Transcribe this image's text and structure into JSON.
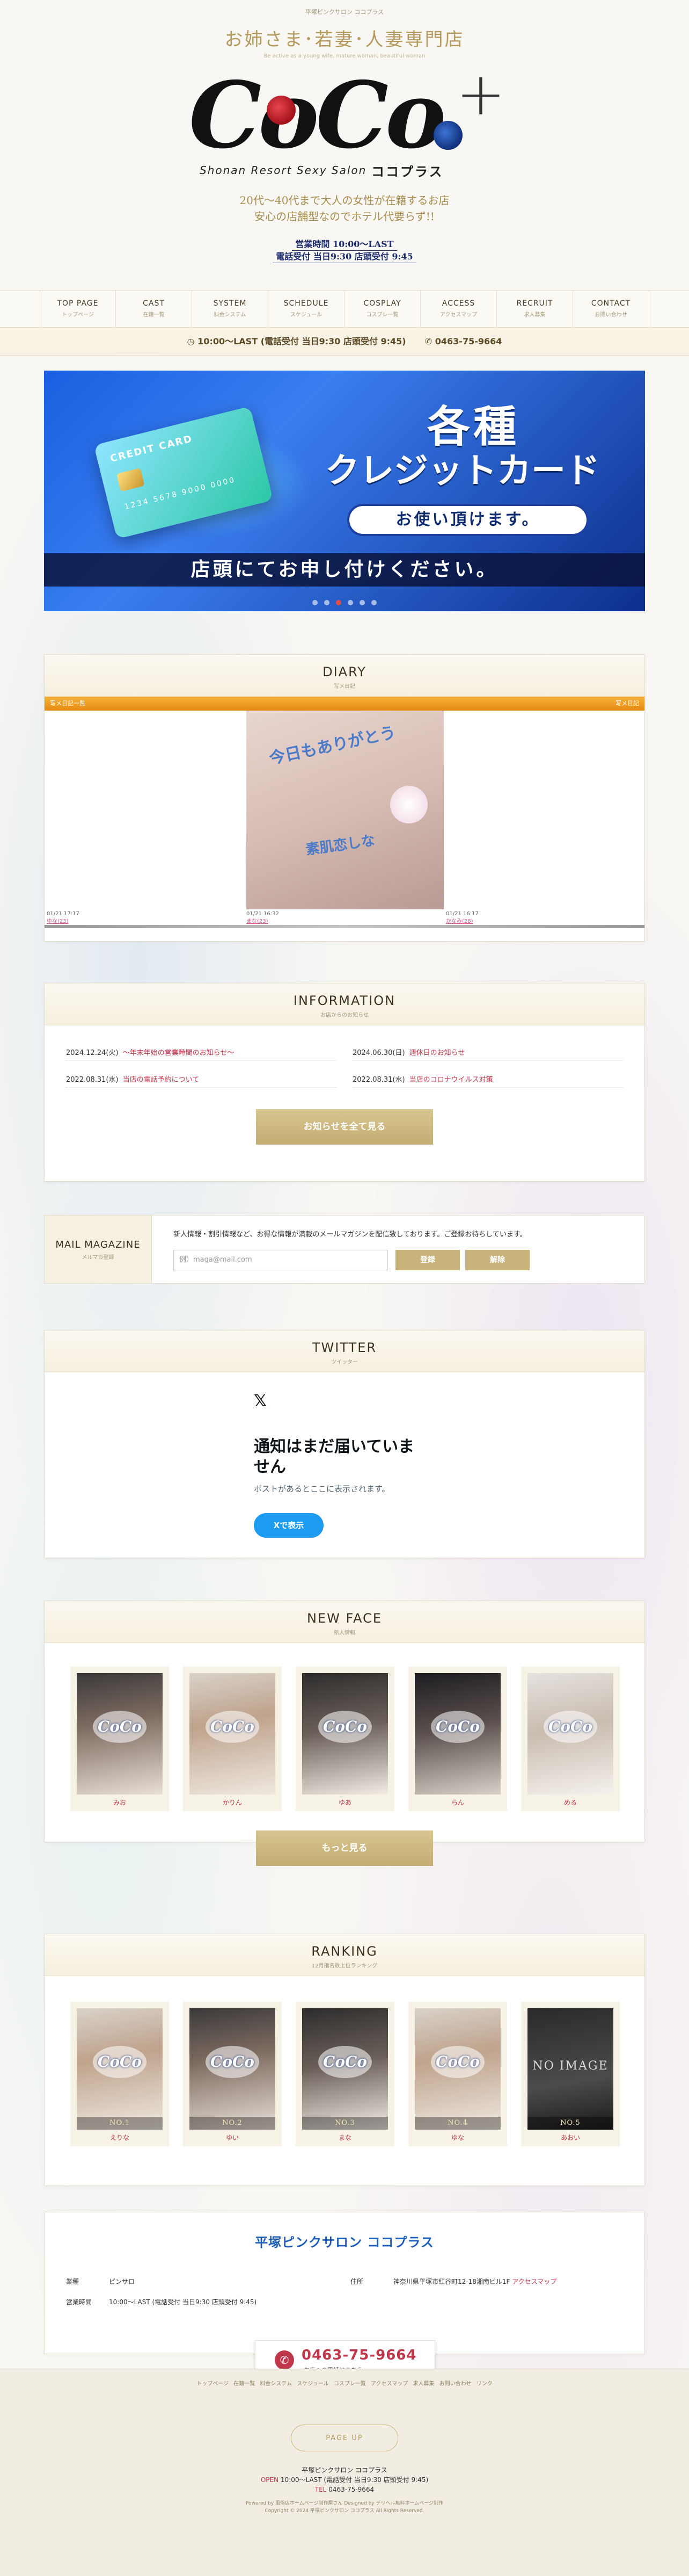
{
  "header": {
    "topline": "平塚ピンクサロン ココプラス",
    "tagline": "お姉さま･若妻･人妻専門店",
    "tagline_sub": "Be active as a young wife, mature woman, beautiful woman",
    "logo_text": "CoCo",
    "logo_plus": "+",
    "logo_english": "Shonan Resort Sexy Salon",
    "logo_kana": "ココプラス",
    "catch_line1": "20代～40代まで大人の女性が在籍するお店",
    "catch_line2": "安心の店舗型なのでホテル代要らず!!",
    "hours_line1": "営業時間 10:00～LAST",
    "hours_line2": "電話受付 当日9:30 店頭受付 9:45"
  },
  "nav": [
    {
      "en": "TOP PAGE",
      "ja": "トップページ"
    },
    {
      "en": "CAST",
      "ja": "在籍一覧"
    },
    {
      "en": "SYSTEM",
      "ja": "料金システム"
    },
    {
      "en": "SCHEDULE",
      "ja": "スケジュール"
    },
    {
      "en": "COSPLAY",
      "ja": "コスプレ一覧"
    },
    {
      "en": "ACCESS",
      "ja": "アクセスマップ"
    },
    {
      "en": "RECRUIT",
      "ja": "求人募集"
    },
    {
      "en": "CONTACT",
      "ja": "お問い合わせ"
    }
  ],
  "infobar": {
    "hours": "10:00～LAST (電話受付 当日9:30 店頭受付 9:45)",
    "tel": "0463-75-9664"
  },
  "banner": {
    "card_label": "CREDIT CARD",
    "card_number": "1234 5678 9000 0000",
    "headline1": "各種",
    "headline2": "クレジットカード",
    "pill": "お使い頂けます。",
    "bottom": "店頭にてお申し付けください。"
  },
  "diary": {
    "title_en": "DIARY",
    "title_ja": "写メ日記",
    "bar_left": "写メ日記一覧",
    "bar_right": "写メ日記",
    "photo_text1": "今日もありがとう",
    "photo_text2": "素肌恋しな",
    "entries": [
      {
        "date": "01/21 17:17",
        "name": "ゆな(23)"
      },
      {
        "date": "01/21 16:32",
        "name": "まな(23)"
      },
      {
        "date": "01/21 16:17",
        "name": "かなみ(28)"
      }
    ]
  },
  "information": {
    "title_en": "INFORMATION",
    "title_ja": "お店からのお知らせ",
    "items": [
      {
        "date": "2024.12.24(火)",
        "title": "～年末年始の営業時間のお知らせ～"
      },
      {
        "date": "2024.06.30(日)",
        "title": "週休日のお知らせ"
      },
      {
        "date": "2022.08.31(水)",
        "title": "当店の電話予約について"
      },
      {
        "date": "2022.08.31(水)",
        "title": "当店のコロナウイルス対策"
      }
    ],
    "more_label": "お知らせを全て見る"
  },
  "mail": {
    "title_en": "MAIL MAGAZINE",
    "title_ja": "メルマガ登録",
    "desc": "新人情報・割引情報など、お得な情報が満載のメールマガジンを配信致しております。ご登録お待ちしています。",
    "placeholder": "例）maga@mail.com",
    "register_label": "登録",
    "cancel_label": "解除"
  },
  "twitter": {
    "title_en": "TWITTER",
    "title_ja": "ツイッター",
    "x_logo": "𝕏",
    "empty_title": "通知はまだ届いていません",
    "empty_sub": "ポストがあるとここに表示されます。",
    "button": "Xで表示"
  },
  "newface": {
    "title_en": "NEW FACE",
    "title_ja": "新人情報",
    "stamp": "CoCo",
    "girls": [
      {
        "name": "みお"
      },
      {
        "name": "かりん"
      },
      {
        "name": "ゆあ"
      },
      {
        "name": "らん"
      },
      {
        "name": "める"
      }
    ],
    "more_label": "もっと見る"
  },
  "ranking": {
    "title_en": "RANKING",
    "title_ja": "12月指名数上位ランキング",
    "stamp": "CoCo",
    "no_image": "NO IMAGE",
    "girls": [
      {
        "rank": "NO.1",
        "name": "えりな"
      },
      {
        "rank": "NO.2",
        "name": "ゆい"
      },
      {
        "rank": "NO.3",
        "name": "まな"
      },
      {
        "rank": "NO.4",
        "name": "ゆな"
      },
      {
        "rank": "NO.5",
        "name": "あおい"
      }
    ]
  },
  "shop": {
    "title": "平塚ピンクサロン ココプラス",
    "type_key": "業種",
    "type_val": "ピンサロ",
    "addr_key": "住所",
    "addr_val": "神奈川県平塚市紅谷町12-18湘南ビル1F",
    "addr_link": "アクセスマップ",
    "hours_key": "営業時間",
    "hours_val": "10:00～LAST (電話受付 当日9:30 店頭受付 9:45)",
    "tel": "0463-75-9664",
    "tel_sub": "お店への電話はこちら",
    "tel_icon": "✆"
  },
  "footer": {
    "links": [
      "トップページ",
      "在籍一覧",
      "料金システム",
      "スケジュール",
      "コスプレ一覧",
      "アクセスマップ",
      "求人募集",
      "お問い合わせ",
      "リンク"
    ],
    "pageup": "PAGE UP",
    "shop_name": "平塚ピンクサロン ココプラス",
    "open_label": "OPEN",
    "open_val": "10:00～LAST (電話受付 当日9:30 店頭受付 9:45)",
    "tel_label": "TEL",
    "tel_val": "0463-75-9664",
    "powered": "Powered by 風俗店ホームページ制作屋さん Designed by デリヘル無料ホームページ制作",
    "copyright": "Copyright © 2024 平塚ピンクサロン ココプラス All Rights Reserved."
  }
}
